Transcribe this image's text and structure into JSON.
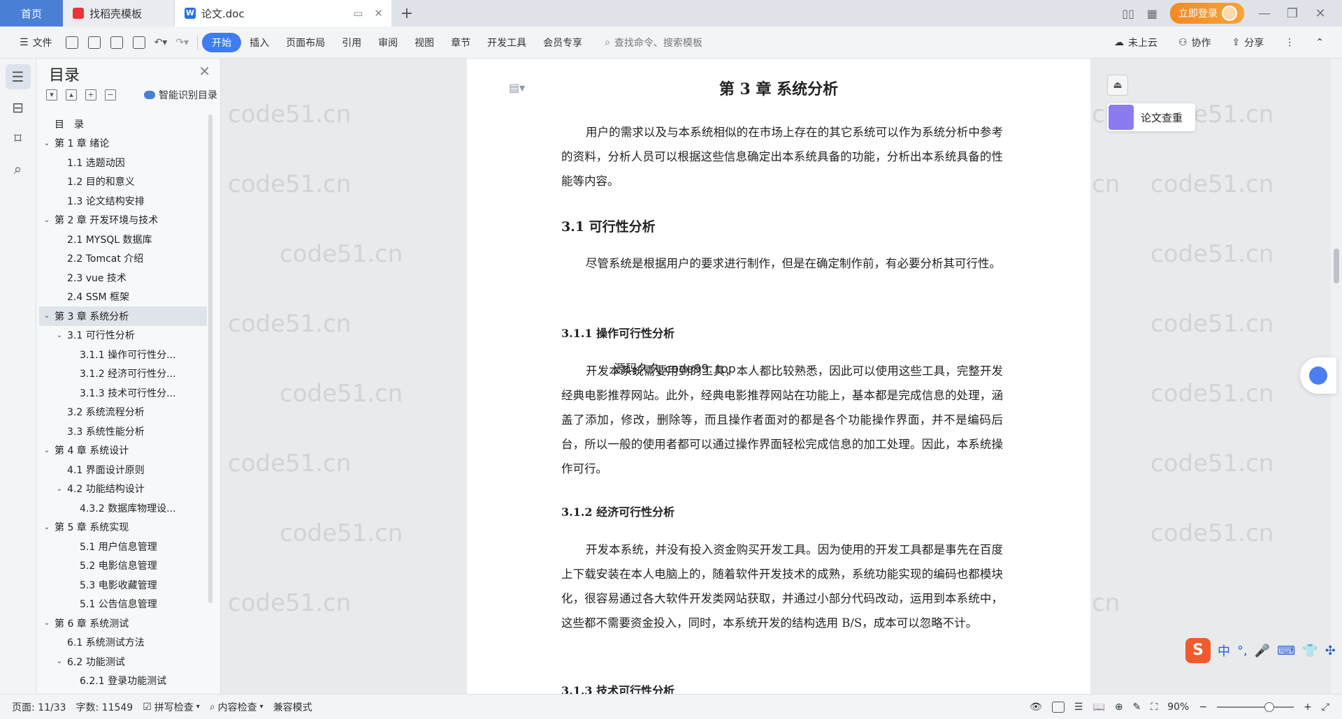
{
  "titlebar": {
    "tabs": [
      {
        "label": "首页"
      },
      {
        "label": "找稻壳模板"
      },
      {
        "label": "论文.doc"
      }
    ],
    "login_label": "立即登录"
  },
  "ribbon": {
    "file_label": "文件",
    "tabs": [
      "开始",
      "插入",
      "页面布局",
      "引用",
      "审阅",
      "视图",
      "章节",
      "开发工具",
      "会员专享"
    ],
    "active_tab": "开始",
    "search_placeholder": "查找命令、搜索模板",
    "cloud_label": "未上云",
    "collab_label": "协作",
    "share_label": "分享"
  },
  "toc": {
    "title": "目录",
    "smart_label": "智能识别目录",
    "items": [
      {
        "label": "目　录",
        "level": 1,
        "chevron": ""
      },
      {
        "label": "第 1 章  绪论",
        "level": 1,
        "chevron": "v"
      },
      {
        "label": "1.1 选题动因",
        "level": 2,
        "chevron": ""
      },
      {
        "label": "1.2 目的和意义",
        "level": 2,
        "chevron": ""
      },
      {
        "label": "1.3 论文结构安排",
        "level": 2,
        "chevron": ""
      },
      {
        "label": "第 2 章  开发环境与技术",
        "level": 1,
        "chevron": "v"
      },
      {
        "label": "2.1 MYSQL 数据库",
        "level": 2,
        "chevron": ""
      },
      {
        "label": "2.2 Tomcat  介绍",
        "level": 2,
        "chevron": ""
      },
      {
        "label": "2.3 vue 技术",
        "level": 2,
        "chevron": ""
      },
      {
        "label": "2.4 SSM 框架",
        "level": 2,
        "chevron": ""
      },
      {
        "label": "第 3 章  系统分析",
        "level": 1,
        "chevron": "v",
        "selected": true
      },
      {
        "label": "3.1 可行性分析",
        "level": 2,
        "chevron": "v"
      },
      {
        "label": "3.1.1 操作可行性分...",
        "level": 3,
        "chevron": ""
      },
      {
        "label": "3.1.2 经济可行性分...",
        "level": 3,
        "chevron": ""
      },
      {
        "label": "3.1.3 技术可行性分...",
        "level": 3,
        "chevron": ""
      },
      {
        "label": "3.2 系统流程分析",
        "level": 2,
        "chevron": ""
      },
      {
        "label": "3.3 系统性能分析",
        "level": 2,
        "chevron": ""
      },
      {
        "label": "第 4 章  系统设计",
        "level": 1,
        "chevron": "v"
      },
      {
        "label": "4.1 界面设计原则",
        "level": 2,
        "chevron": ""
      },
      {
        "label": "4.2 功能结构设计",
        "level": 2,
        "chevron": "v"
      },
      {
        "label": "4.3.2  数据库物理设...",
        "level": 3,
        "chevron": ""
      },
      {
        "label": "第 5 章  系统实现",
        "level": 1,
        "chevron": "v"
      },
      {
        "label": "5.1 用户信息管理",
        "level": 3,
        "chevron": ""
      },
      {
        "label": "5.2  电影信息管理",
        "level": 3,
        "chevron": ""
      },
      {
        "label": "5.3 电影收藏管理",
        "level": 3,
        "chevron": ""
      },
      {
        "label": "5.1 公告信息管理",
        "level": 3,
        "chevron": ""
      },
      {
        "label": "第 6 章  系统测试",
        "level": 1,
        "chevron": "v"
      },
      {
        "label": "6.1  系统测试方法",
        "level": 2,
        "chevron": ""
      },
      {
        "label": "6.2  功能测试",
        "level": 2,
        "chevron": "v"
      },
      {
        "label": "6.2.1  登录功能测试",
        "level": 3,
        "chevron": ""
      }
    ]
  },
  "document": {
    "chapter_title": "第 3 章  系统分析",
    "intro": "用户的需求以及与本系统相似的在市场上存在的其它系统可以作为系统分析中参考的资料，分析人员可以根据这些信息确定出本系统具备的功能，分析出本系统具备的性能等内容。",
    "s31_title": "3.1 可行性分析",
    "s31_para": "尽管系统是根据用户的要求进行制作，但是在确定制作前，有必要分析其可行性。",
    "s311_title": "3.1.1 操作可行性分析",
    "s311_para": "开发本系统需要用到的工具，本人都比较熟悉，因此可以使用这些工具，完整开发经典电影推荐网站。此外，经典电影推荐网站在功能上，基本都是完成信息的处理，涵盖了添加，修改，删除等，而且操作者面对的都是各个功能操作界面，并不是编码后台，所以一般的使用者都可以通过操作界面轻松完成信息的加工处理。因此，本系统操作可行。",
    "overlay_text": "源码久久 code99. top",
    "s312_title": "3.1.2 经济可行性分析",
    "s312_para": "开发本系统，并没有投入资金购买开发工具。因为使用的开发工具都是事先在百度上下载安装在本人电脑上的，随着软件开发技术的成熟，系统功能实现的编码也都模块化，很容易通过各大软件开发类网站获取，并通过小部分代码改动，运用到本系统中，这些都不需要资金投入，同时，本系统开发的结构选用 B/S，成本可以忽略不计。",
    "s313_title": "3.1.3 技术可行性分析"
  },
  "right_panel": {
    "check_label": "论文查重"
  },
  "watermark": "code51.cn",
  "ime": {
    "lang": "中"
  },
  "statusbar": {
    "page": "页面: 11/33",
    "words": "字数: 11549",
    "spell": "拼写检查",
    "content_check": "内容检查",
    "compat": "兼容模式",
    "zoom": "90%"
  },
  "colors": {
    "accent": "#3d7cf2",
    "home_tab": "#4a7fd6",
    "login": "#f08a24"
  }
}
